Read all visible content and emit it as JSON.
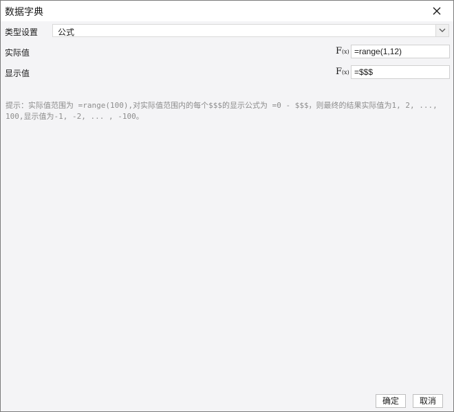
{
  "dialog": {
    "title": "数据字典"
  },
  "type_setting": {
    "label": "类型设置",
    "selected": "公式"
  },
  "actual_value": {
    "label": "实际值",
    "fx_text": "F",
    "fx_sub": "(x)",
    "value": "=range(1,12)"
  },
  "display_value": {
    "label": "显示值",
    "fx_text": "F",
    "fx_sub": "(x)",
    "value": "=$$$"
  },
  "hint": {
    "text": "提示：实际值范围为 =range(100),对实际值范围内的每个$$$的显示公式为 =0 - $$$，则最终的结果实际值为1, 2, ..., 100,显示值为-1, -2, ... , -100。"
  },
  "footer": {
    "ok_label": "确定",
    "cancel_label": "取消"
  }
}
